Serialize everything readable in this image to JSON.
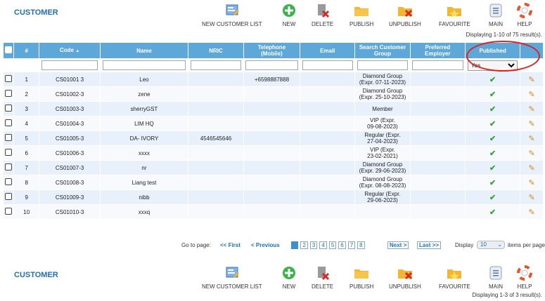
{
  "toolbar": {
    "title": "CUSTOMER",
    "buttons": {
      "new_customer_list": "NEW CUSTOMER LIST",
      "new": "NEW",
      "delete": "DELETE",
      "publish": "PUBLISH",
      "unpublish": "UNPUBLISH",
      "favourite": "FAVOURITE",
      "main": "MAIN",
      "help": "HELP"
    }
  },
  "displaying_top": "Displaying 1-10 of 75 result(s).",
  "displaying_bottom": "Displaying 1-3 of 3 result(s).",
  "table": {
    "headers": {
      "num": "#",
      "code": "Code",
      "code_sort": "▲",
      "name": "Name",
      "nric": "NRIC",
      "telephone_1": "Telephone",
      "telephone_2": "(Mobile)",
      "email": "Email",
      "group_1": "Search Customer",
      "group_2": "Group",
      "employer_1": "Preferred",
      "employer_2": "Employer",
      "published": "Published"
    },
    "published_filter": "Yes",
    "rows": [
      {
        "num": "1",
        "code": "CS01001 3",
        "name": "Leo",
        "nric": "",
        "tel": "+6598887888",
        "email": "",
        "group1": "Diamond Group",
        "group2": "(Expr. 07-11-2023)"
      },
      {
        "num": "2",
        "code": "CS01002-3",
        "name": "zene",
        "nric": "",
        "tel": "",
        "email": "",
        "group1": "Diamond Group",
        "group2": "(Expr. 25-10-2023)"
      },
      {
        "num": "3",
        "code": "CS01003-3",
        "name": "sherryGST",
        "nric": "",
        "tel": "",
        "email": "",
        "group1": "Member",
        "group2": ""
      },
      {
        "num": "4",
        "code": "CS01004-3",
        "name": "LIM HQ",
        "nric": "",
        "tel": "",
        "email": "",
        "group1": "VIP (Expr.",
        "group2": "09-08-2023)"
      },
      {
        "num": "5",
        "code": "CS01005-3",
        "name": "DA- IVORY",
        "nric": "4546545646",
        "tel": "",
        "email": "",
        "group1": "Regular (Expr.",
        "group2": "27-04-2023)"
      },
      {
        "num": "6",
        "code": "CS01006-3",
        "name": "xxxx",
        "nric": "",
        "tel": "",
        "email": "",
        "group1": "VIP (Expr.",
        "group2": "23-02-2021)"
      },
      {
        "num": "7",
        "code": "CS01007-3",
        "name": "nr",
        "nric": "",
        "tel": "",
        "email": "",
        "group1": "Diamond Group",
        "group2": "(Expr. 29-06-2023)"
      },
      {
        "num": "8",
        "code": "CS01008-3",
        "name": "Liang test",
        "nric": "",
        "tel": "",
        "email": "",
        "group1": "Diamond Group",
        "group2": "(Expr. 08-08-2023)"
      },
      {
        "num": "9",
        "code": "CS01009-3",
        "name": "nibb",
        "nric": "",
        "tel": "",
        "email": "",
        "group1": "Regular (Expr.",
        "group2": "29-06-2023)"
      },
      {
        "num": "10",
        "code": "CS01010-3",
        "name": "xxxq",
        "nric": "",
        "tel": "",
        "email": "",
        "group1": "",
        "group2": ""
      }
    ],
    "published_mark": "✔",
    "edit_mark": "✎"
  },
  "pager": {
    "go_to": "Go to page:",
    "first": "<< First",
    "previous": "< Previous",
    "pages": [
      "1",
      "2",
      "3",
      "4",
      "5",
      "6",
      "7",
      "8"
    ],
    "current": "1",
    "next": "Next >",
    "last": "Last >>",
    "display": "Display",
    "per_page_value": "10",
    "items_per_page": "items per page"
  },
  "colors": {
    "header_bg": "#5ea8d9",
    "title": "#1f6fb5",
    "annotation_circle": "#e02020"
  }
}
